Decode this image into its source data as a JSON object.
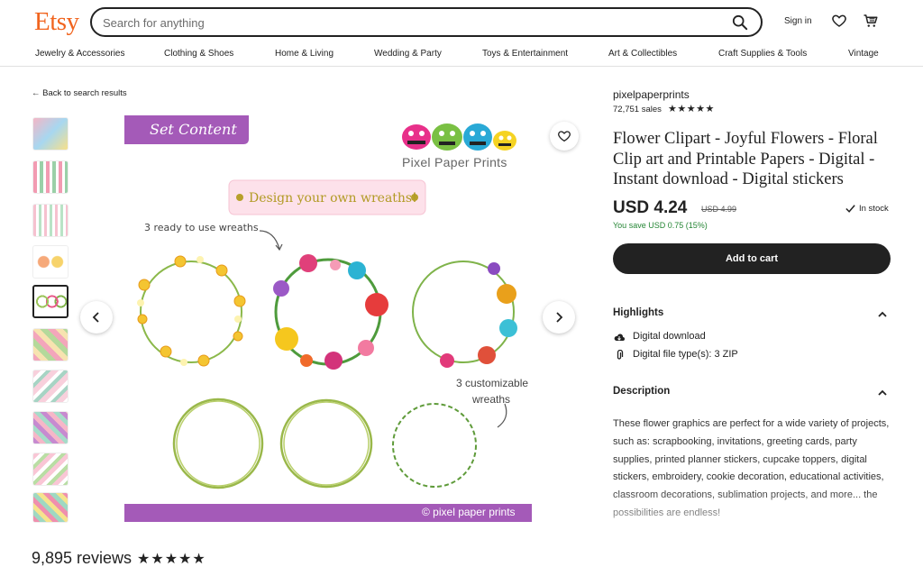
{
  "header": {
    "logo": "Etsy",
    "search_placeholder": "Search for anything",
    "sign_in": "Sign in"
  },
  "categories": [
    "Jewelry & Accessories",
    "Clothing & Shoes",
    "Home & Living",
    "Wedding & Party",
    "Toys & Entertainment",
    "Art & Collectibles",
    "Craft Supplies & Tools",
    "Vintage"
  ],
  "back_link": "Back to search results",
  "gallery": {
    "thumbnail_count": 10,
    "selected_index": 4,
    "banner_label": "Set Content",
    "brand_name": "Pixel Paper Prints",
    "tagline": "Design your own wreaths!",
    "note_ready": "3 ready to use wreaths",
    "note_custom_1": "3 customizable",
    "note_custom_2": "wreaths",
    "footer": "© pixel paper prints"
  },
  "reviews": {
    "count_label": "9,895 reviews",
    "stars": "★★★★★"
  },
  "product": {
    "shop_name": "pixelpaperprints",
    "sales": "72,751 sales",
    "shop_stars": "★★★★★",
    "title": "Flower Clipart - Joyful Flowers - Floral Clip art and Printable Papers - Digital - Instant download - Digital stickers",
    "price": "USD 4.24",
    "original_price": "USD 4.99",
    "stock": "In stock",
    "savings": "You save USD 0.75 (15%)",
    "add_to_cart": "Add to cart"
  },
  "highlights": {
    "heading": "Highlights",
    "items": [
      "Digital download",
      "Digital file type(s): 3 ZIP"
    ]
  },
  "description": {
    "heading": "Description",
    "text": "These flower graphics are perfect for a wide variety of projects, such as: scrapbooking, invitations, greeting cards, party supplies, printed planner stickers, cupcake toppers, digital stickers, embroidery, cookie decoration, educational activities, classroom decorations, sublimation projects, and more... the possibilities are endless!"
  },
  "colors": {
    "brand": "#f1641e",
    "button": "#222222",
    "savings": "#258635",
    "banner_purple": "#a45ab8"
  }
}
